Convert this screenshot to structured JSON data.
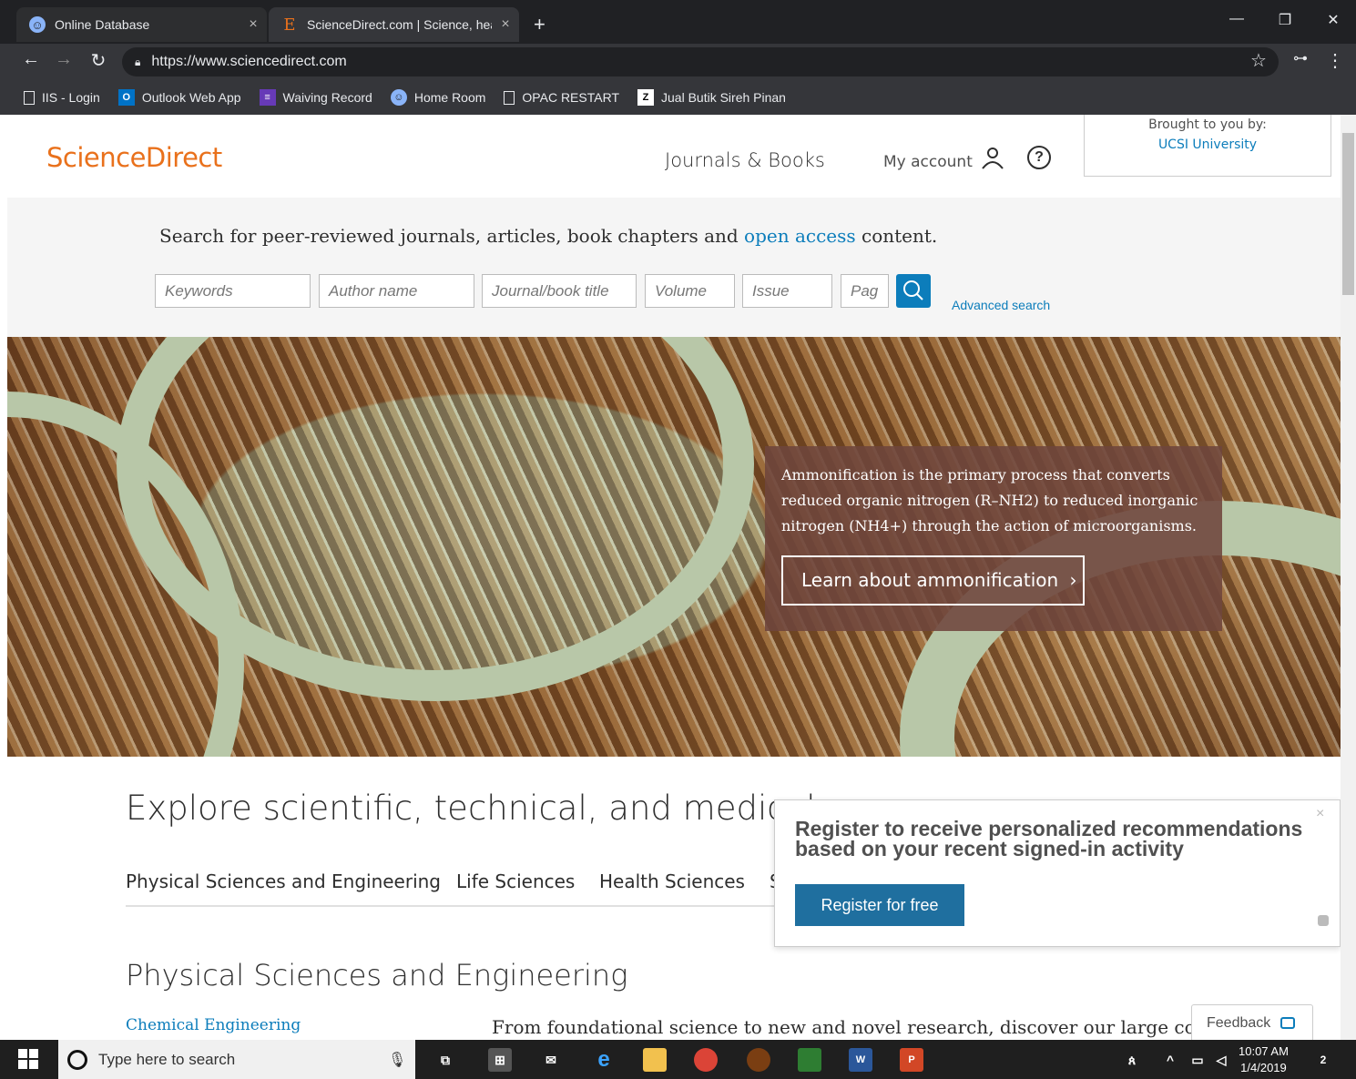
{
  "browser": {
    "tabs": [
      {
        "title": "Online Database",
        "active": false
      },
      {
        "title": "ScienceDirect.com | Science, heal",
        "active": true
      }
    ],
    "url": "https://www.sciencedirect.com",
    "bookmarks": [
      {
        "label": "IIS - Login",
        "icon": "page-icon"
      },
      {
        "label": "Outlook Web App",
        "icon": "outlook-icon"
      },
      {
        "label": "Waiving Record",
        "icon": "list-icon"
      },
      {
        "label": "Home Room",
        "icon": "globe-icon"
      },
      {
        "label": "OPAC RESTART",
        "icon": "page-icon"
      },
      {
        "label": "Jual Butik Sireh Pinan",
        "icon": "z-icon"
      }
    ]
  },
  "header": {
    "logo": "ScienceDirect",
    "journals_books": "Journals & Books",
    "my_account": "My account",
    "help": "?",
    "brought_by": "Brought to you by:",
    "institution": "UCSI University"
  },
  "search": {
    "intro_before": "Search for peer-reviewed journals, articles, book chapters and ",
    "intro_link": "open access",
    "intro_after": " content.",
    "fields": [
      {
        "placeholder": "Keywords"
      },
      {
        "placeholder": "Author name"
      },
      {
        "placeholder": "Journal/book title"
      },
      {
        "placeholder": "Volume"
      },
      {
        "placeholder": "Issue"
      },
      {
        "placeholder": "Pag"
      }
    ],
    "advanced": "Advanced search"
  },
  "hero": {
    "text": "Ammonification is the primary process that converts reduced organic nitrogen (R–NH2) to reduced inorganic nitrogen (NH4+) through the action of microorganisms.",
    "button": "Learn about ammonification",
    "button_icon": "chevron-right-icon"
  },
  "explore": {
    "heading": "Explore scientific, technical, and medical r",
    "tabs": [
      "Physical Sciences and Engineering",
      "Life Sciences",
      "Health Sciences",
      "S"
    ],
    "section_heading": "Physical Sciences and Engineering",
    "first_link": "Chemical Engineering",
    "description": "From foundational science to new and novel research, discover our large collectio"
  },
  "popup": {
    "text": "Register to receive personalized recommendations based on your recent signed-in activity",
    "button": "Register for free",
    "close": "×"
  },
  "feedback": "Feedback",
  "taskbar": {
    "search_placeholder": "Type here to search",
    "time": "10:07 AM",
    "date": "1/4/2019",
    "notification_count": "2"
  },
  "colors": {
    "brand": "#e9711c",
    "link": "#0c7dbb",
    "chrome_dark": "#202124"
  }
}
